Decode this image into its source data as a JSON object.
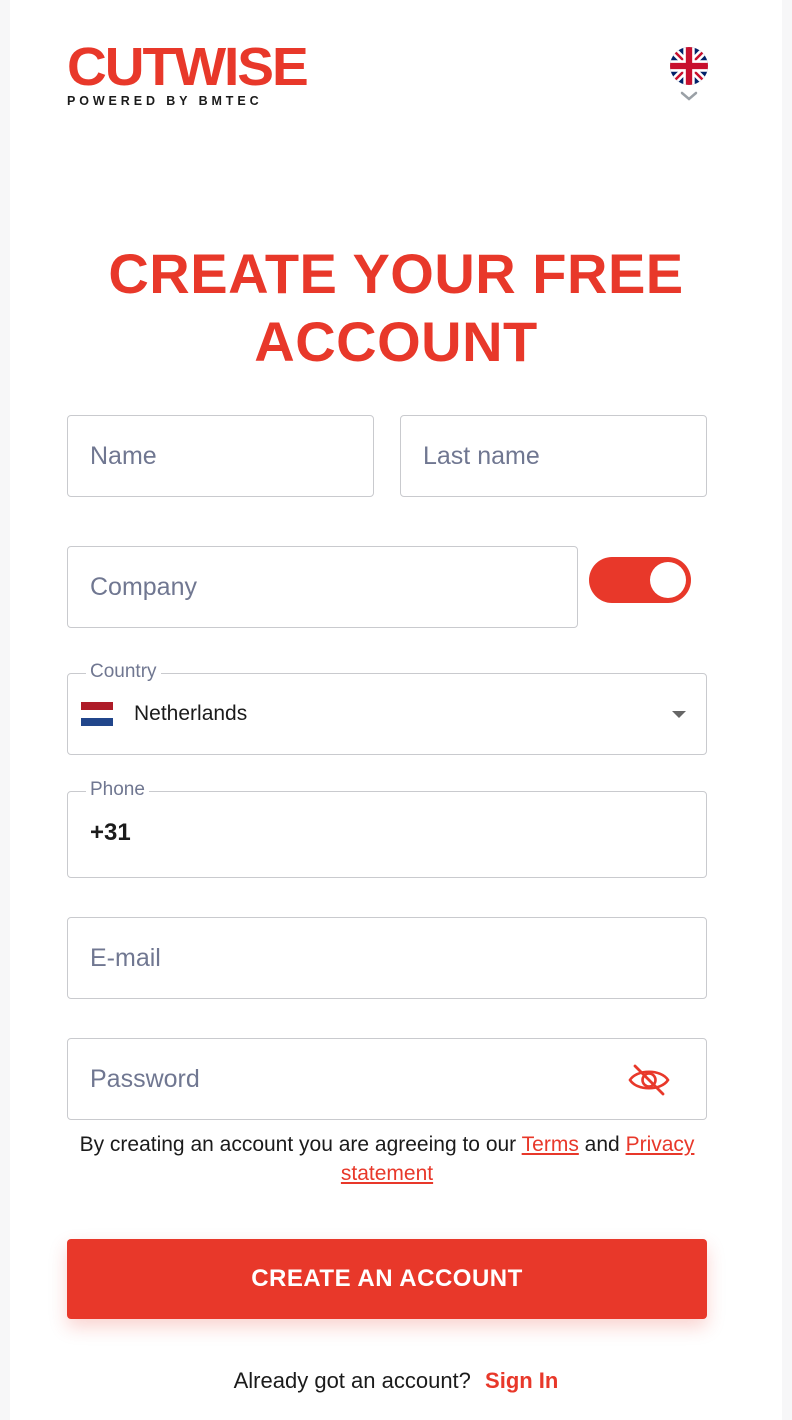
{
  "brand": {
    "name": "CUTWISE",
    "tagline": "POWERED BY BMTEC",
    "accent": "#e8382a"
  },
  "language": {
    "current": "English (UK)",
    "flag_icon": "uk-flag-icon",
    "dropdown_icon": "chevron-down-icon"
  },
  "title": {
    "line1": "CREATE YOUR FREE",
    "line2": "ACCOUNT"
  },
  "form": {
    "name": {
      "placeholder": "Name",
      "value": ""
    },
    "last_name": {
      "placeholder": "Last name",
      "value": ""
    },
    "company": {
      "placeholder": "Company",
      "value": "",
      "toggle_on": true
    },
    "country": {
      "label": "Country",
      "value": "Netherlands",
      "flag_colors": [
        "#ae1c28",
        "#ffffff",
        "#21468b"
      ]
    },
    "phone": {
      "label": "Phone",
      "value": "+31"
    },
    "email": {
      "placeholder": "E-mail",
      "value": ""
    },
    "password": {
      "placeholder": "Password",
      "value": "",
      "visibility_icon": "eye-off-icon"
    }
  },
  "consent": {
    "text": "By creating an account you are agreeing to our",
    "terms_link": "Terms",
    "and": "and",
    "privacy_link": "Privacy statement"
  },
  "submit_label": "CREATE AN ACCOUNT",
  "signin": {
    "prompt": "Already got an account?",
    "link": "Sign In"
  }
}
